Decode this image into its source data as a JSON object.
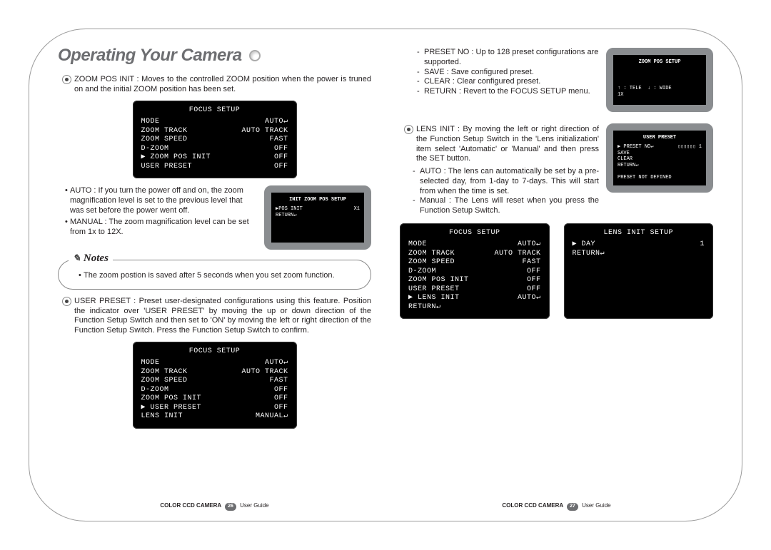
{
  "title": "Operating Your Camera",
  "left": {
    "zoom_pos_init": {
      "label": "ZOOM POS INIT",
      "text": "Moves to the controlled ZOOM position when the power is truned on and the initial ZOOM position has been set."
    },
    "osd1": {
      "title": "FOCUS SETUP",
      "rows": [
        [
          "MODE",
          "AUTO↵"
        ],
        [
          "ZOOM TRACK",
          "AUTO TRACK"
        ],
        [
          "ZOOM SPEED",
          "FAST"
        ],
        [
          "D-ZOOM",
          "OFF"
        ],
        [
          "▶ ZOOM POS INIT",
          "OFF"
        ],
        [
          "USER PRESET",
          "OFF"
        ]
      ]
    },
    "auto": {
      "label": "AUTO",
      "text": "If you turn the power off and on, the zoom magnification level is set to the previous level that was set before the power went off."
    },
    "manual": {
      "label": "MANUAL",
      "text": "The zoom magnification level can be set from 1x to 12X."
    },
    "monitor1": {
      "title": "INIT ZOOM POS SETUP",
      "rows": [
        [
          "▶POS INIT",
          "X1"
        ],
        [
          "RETURN↵",
          ""
        ]
      ]
    },
    "note": "The zoom postion is saved after 5 seconds when you set zoom function.",
    "user_preset": {
      "label": "USER PRESET",
      "text": "Preset user-designated configurations using this feature. Position the indicator over 'USER PRESET' by moving the up or down direction of the Function Setup Switch and then set to 'ON' by moving the left or right direction of the Function Setup Switch. Press the Function Setup Switch to confirm."
    },
    "osd2": {
      "title": "FOCUS SETUP",
      "rows": [
        [
          "MODE",
          "AUTO↵"
        ],
        [
          "ZOOM TRACK",
          "AUTO TRACK"
        ],
        [
          "ZOOM SPEED",
          "FAST"
        ],
        [
          "D-ZOOM",
          "OFF"
        ],
        [
          "ZOOM POS INIT",
          "OFF"
        ],
        [
          "▶ USER PRESET",
          "OFF"
        ],
        [
          "LENS INIT",
          "MANUAL↵"
        ]
      ]
    },
    "footer": {
      "product": "COLOR CCD CAMERA",
      "page": "26",
      "guide": "User Guide"
    }
  },
  "right": {
    "bullets": [
      {
        "label": "PRESET NO",
        "text": "Up to 128 preset configurations are supported."
      },
      {
        "label": "SAVE",
        "text": "Save configured preset."
      },
      {
        "label": "CLEAR",
        "text": "Clear configured preset."
      },
      {
        "label": "RETURN",
        "text": "Revert to the FOCUS SETUP menu."
      }
    ],
    "monitor2": {
      "title": "ZOOM POS SETUP",
      "rows": [],
      "footer": "↑ : TELE  ↓ : WIDE\n1X"
    },
    "lens_init": {
      "label": "LENS INIT",
      "text": "By moving the left or right direction of the Function Setup Switch in the 'Lens initialization' item select 'Automatic' or 'Manual' and then press the SET button."
    },
    "sub_auto": {
      "label": "AUTO",
      "text": "The lens can automatically be set by a pre-selected day, from 1-day to 7-days. This will start from when the time is set."
    },
    "sub_manual": {
      "label": "Manual",
      "text": "The Lens will reset when you press the Function Setup Switch."
    },
    "monitor3": {
      "title": "USER PRESET",
      "rows": [
        [
          "▶ PRESET NO↵",
          "▯▯▯▯▯▯ 1"
        ],
        [
          "SAVE",
          ""
        ],
        [
          "CLEAR",
          ""
        ],
        [
          "RETURN↵",
          ""
        ]
      ],
      "footer": "PRESET NOT DEFINED"
    },
    "osd3": {
      "title": "FOCUS SETUP",
      "rows": [
        [
          "MODE",
          "AUTO↵"
        ],
        [
          "ZOOM TRACK",
          "AUTO TRACK"
        ],
        [
          "ZOOM SPEED",
          "FAST"
        ],
        [
          "D-ZOOM",
          "OFF"
        ],
        [
          "ZOOM POS INIT",
          "OFF"
        ],
        [
          "USER PRESET",
          "OFF"
        ],
        [
          "▶ LENS INIT",
          "AUTO↵"
        ],
        [
          "RETURN↵",
          ""
        ]
      ]
    },
    "osd4": {
      "title": "LENS INIT SETUP",
      "rows": [
        [
          "▶ DAY",
          "1"
        ],
        [
          "RETURN↵",
          ""
        ]
      ]
    },
    "footer": {
      "product": "COLOR CCD CAMERA",
      "page": "27",
      "guide": "User Guide"
    }
  },
  "notes_label": "Notes"
}
